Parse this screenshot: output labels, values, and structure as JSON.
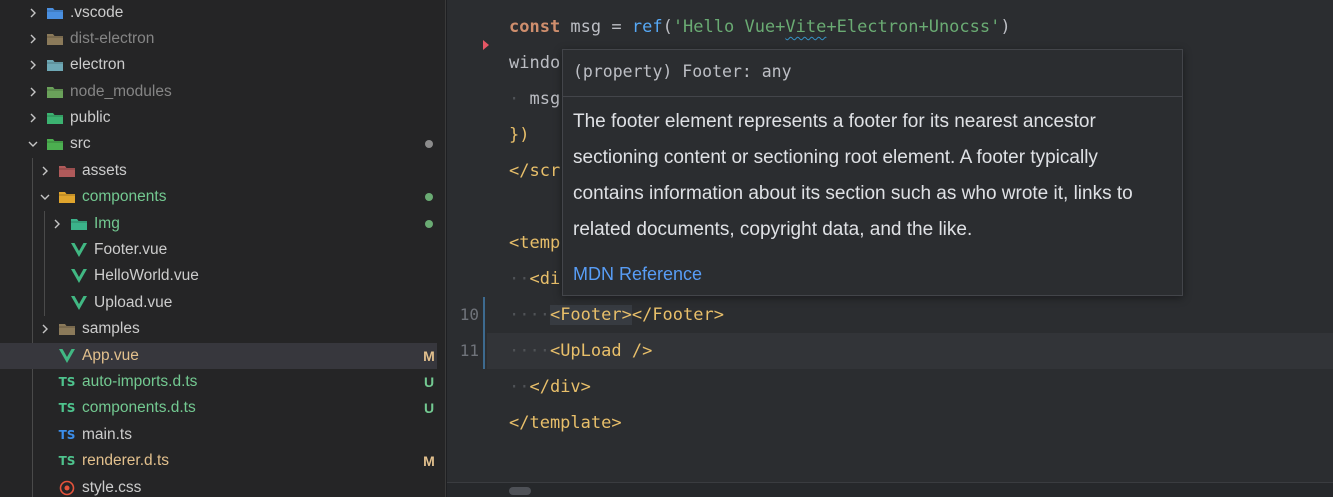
{
  "explorer": {
    "items": [
      {
        "label": ".vscode",
        "expanded": false,
        "depth": 0,
        "icon": "vscode-folder-icon",
        "dim": false
      },
      {
        "label": "dist-electron",
        "expanded": false,
        "depth": 0,
        "icon": "folder-icon",
        "dim": true
      },
      {
        "label": "electron",
        "expanded": false,
        "depth": 0,
        "icon": "electron-folder-icon",
        "dim": false
      },
      {
        "label": "node_modules",
        "expanded": false,
        "depth": 0,
        "icon": "node-folder-icon",
        "dim": true
      },
      {
        "label": "public",
        "expanded": false,
        "depth": 0,
        "icon": "public-folder-icon",
        "dim": false
      },
      {
        "label": "src",
        "expanded": true,
        "depth": 0,
        "icon": "src-folder-icon",
        "dim": false
      },
      {
        "label": "assets",
        "expanded": false,
        "depth": 1,
        "icon": "assets-folder-icon",
        "dim": false
      },
      {
        "label": "components",
        "expanded": true,
        "depth": 1,
        "icon": "components-folder-icon",
        "dim": false
      },
      {
        "label": "Img",
        "expanded": false,
        "depth": 2,
        "icon": "image-folder-icon",
        "dim": false
      },
      {
        "label": "Footer.vue",
        "depth": 2,
        "icon": "vue-file-icon",
        "dim": false
      },
      {
        "label": "HelloWorld.vue",
        "depth": 2,
        "icon": "vue-file-icon",
        "dim": false
      },
      {
        "label": "Upload.vue",
        "depth": 2,
        "icon": "vue-file-icon",
        "dim": false
      },
      {
        "label": "samples",
        "expanded": false,
        "depth": 1,
        "icon": "folder-icon",
        "dim": false
      },
      {
        "label": "App.vue",
        "depth": 1,
        "icon": "vue-file-icon",
        "dim": false
      },
      {
        "label": "auto-imports.d.ts",
        "depth": 1,
        "icon": "ts-file-icon",
        "dim": false
      },
      {
        "label": "components.d.ts",
        "depth": 1,
        "icon": "ts-file-icon",
        "dim": false
      },
      {
        "label": "main.ts",
        "depth": 1,
        "icon": "ts-file-icon",
        "dim": false
      },
      {
        "label": "renderer.d.ts",
        "depth": 1,
        "icon": "ts-file-icon",
        "dim": false
      },
      {
        "label": "style.css",
        "depth": 1,
        "icon": "css-file-icon",
        "dim": false
      }
    ],
    "badges": {
      "App.vue": "M",
      "auto-imports.d.ts": "U",
      "components.d.ts": "U",
      "renderer.d.ts": "M"
    },
    "colors": {
      "modified": "#e2c08d",
      "untracked": "#73c991",
      "green_label": "#73c991",
      "modified_dot": "#8c8c8c",
      "changed_dot": "#6aab73",
      "vue": "#41b883",
      "ts_green": "#4ec38d",
      "ts_blue": "#3b8eea",
      "css": "#e5533b"
    }
  },
  "editor": {
    "line_numbers": {
      "footer_line": "10",
      "upload_line": "11"
    },
    "lines": {
      "const_kw": "const",
      "msg_var": " msg = ",
      "ref_fn": "ref",
      "paren_open": "(",
      "str_part1": "'Hello Vue+",
      "str_vite": "Vite",
      "str_part2": "+Electron+Unocss'",
      "paren_close": ")",
      "window_frag": "windo",
      "msg_frag": "msg",
      "close_brace": "})",
      "script_close": "</scr",
      "template_open": "<temp",
      "div_open_frag": "<di",
      "footer_tag_open": "<Footer>",
      "footer_tag_close": "</Footer>",
      "upload_tag": "<UpLoad />",
      "div_close": "</div>",
      "template_close": "</template>"
    }
  },
  "tooltip": {
    "signature": "(property) Footer: any",
    "doc_lines": [
      "The footer element represents a footer for its nearest ancestor",
      "sectioning content or sectioning root element. A footer typically",
      "contains information about its section such as who wrote it, links to",
      "related documents, copyright data, and the like."
    ],
    "link": "MDN Reference"
  }
}
